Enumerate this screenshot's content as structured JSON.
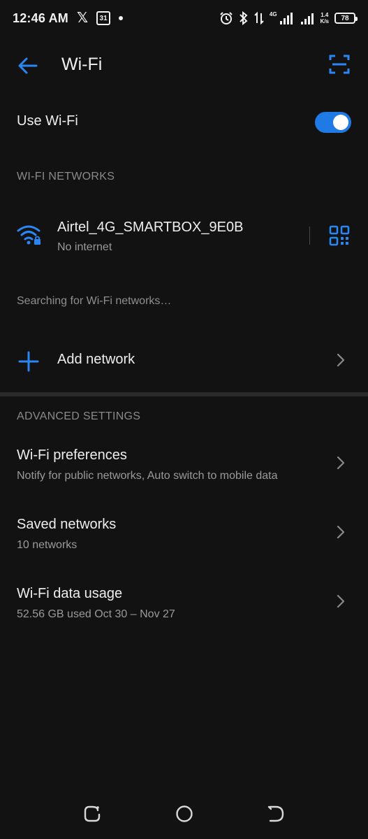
{
  "status_bar": {
    "time": "12:46 AM",
    "calendar_day": "31",
    "network_gen": "4G",
    "speed_value": "1.4",
    "speed_unit": "K/s",
    "battery": "78"
  },
  "app_bar": {
    "title": "Wi-Fi"
  },
  "use_wifi": {
    "label": "Use Wi-Fi",
    "enabled": true
  },
  "networks": {
    "header": "WI-FI NETWORKS",
    "items": [
      {
        "name": "Airtel_4G_SMARTBOX_9E0B",
        "status": "No internet"
      }
    ],
    "searching_text": "Searching for Wi-Fi networks…"
  },
  "add_network": {
    "label": "Add network"
  },
  "advanced": {
    "header": "ADVANCED SETTINGS",
    "items": [
      {
        "title": "Wi-Fi preferences",
        "subtitle": "Notify for public networks, Auto switch to mobile data"
      },
      {
        "title": "Saved networks",
        "subtitle": "10 networks"
      },
      {
        "title": "Wi-Fi data usage",
        "subtitle": "52.56 GB used Oct 30 – Nov 27"
      }
    ]
  },
  "colors": {
    "background": "#121212",
    "accent": "#1f7ae6",
    "primary_text": "#eeeeee",
    "secondary_text": "#9a9a9a"
  },
  "icons": {
    "back": "arrow-left-icon",
    "scan": "scan-frame-icon",
    "wifi": "wifi-lock-icon",
    "qr": "qr-code-icon",
    "add": "plus-icon",
    "chevron": "chevron-right-icon",
    "nav_recents": "recents-icon",
    "nav_home": "home-icon",
    "nav_back": "back-nav-icon"
  }
}
